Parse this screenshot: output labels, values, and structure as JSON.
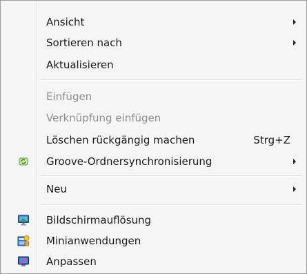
{
  "menu": {
    "items": [
      {
        "label": "Ansicht",
        "submenu": true
      },
      {
        "label": "Sortieren nach",
        "submenu": true
      },
      {
        "label": "Aktualisieren"
      },
      {
        "label": "Einfügen",
        "disabled": true
      },
      {
        "label": "Verknüpfung einfügen",
        "disabled": true
      },
      {
        "label": "Löschen rückgängig machen",
        "shortcut": "Strg+Z"
      },
      {
        "label": "Groove-Ordnersynchronisierung",
        "submenu": true,
        "icon": "groove-sync-icon"
      },
      {
        "label": "Neu",
        "submenu": true
      },
      {
        "label": "Bildschirmauflösung",
        "icon": "monitor-icon"
      },
      {
        "label": "Minianwendungen",
        "icon": "gadgets-icon"
      },
      {
        "label": "Anpassen",
        "icon": "personalize-icon"
      }
    ]
  },
  "colors": {
    "background": "#f5f5f5",
    "disabled_text": "#8d8d8d",
    "text": "#1a1a1a"
  }
}
